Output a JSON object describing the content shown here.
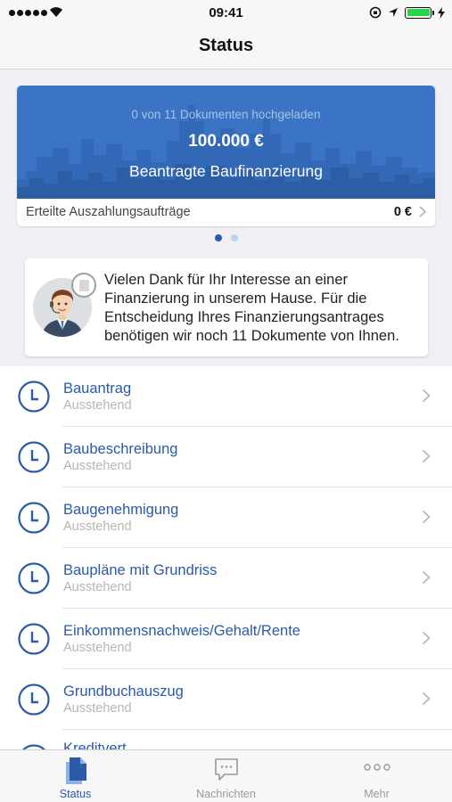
{
  "status_bar": {
    "time": "09:41",
    "signal_icon": "signal-dots-icon",
    "wifi_icon": "wifi-icon",
    "location_icon": "location-arrow-icon",
    "battery_level": 1.0
  },
  "nav": {
    "title": "Status"
  },
  "card": {
    "subtitle": "0 von 11 Dokumenten hochgeladen",
    "amount": "100.000 €",
    "label": "Beantragte Baufinanzierung",
    "row_label": "Erteilte Auszahlungsaufträge",
    "row_value": "0 €",
    "hero_color": "#3b74c4"
  },
  "pager": {
    "count": 2,
    "active": 0
  },
  "message": {
    "text": "Vielen Dank für Ihr Interesse an einer Finanzierung in unserem Hause. Für die Entscheidung Ihres Finanzierungsantrages benötigen wir noch 11 Dokumente von Ihnen."
  },
  "documents": [
    {
      "title": "Bauantrag",
      "status": "Ausstehend"
    },
    {
      "title": "Baubeschreibung",
      "status": "Ausstehend"
    },
    {
      "title": "Baugenehmigung",
      "status": "Ausstehend"
    },
    {
      "title": "Baupläne mit Grundriss",
      "status": "Ausstehend"
    },
    {
      "title": "Einkommensnachweis/Gehalt/Rente",
      "status": "Ausstehend"
    },
    {
      "title": "Grundbuchauszug",
      "status": "Ausstehend"
    },
    {
      "title": "Kreditvert…",
      "status": ""
    }
  ],
  "tabs": [
    {
      "label": "Status",
      "icon": "documents-icon",
      "active": true
    },
    {
      "label": "Nachrichten",
      "icon": "chat-bubble-icon",
      "active": false
    },
    {
      "label": "Mehr",
      "icon": "more-dots-icon",
      "active": false
    }
  ],
  "colors": {
    "accent": "#2a5aa8",
    "status_gray": "#b5b5b5"
  }
}
